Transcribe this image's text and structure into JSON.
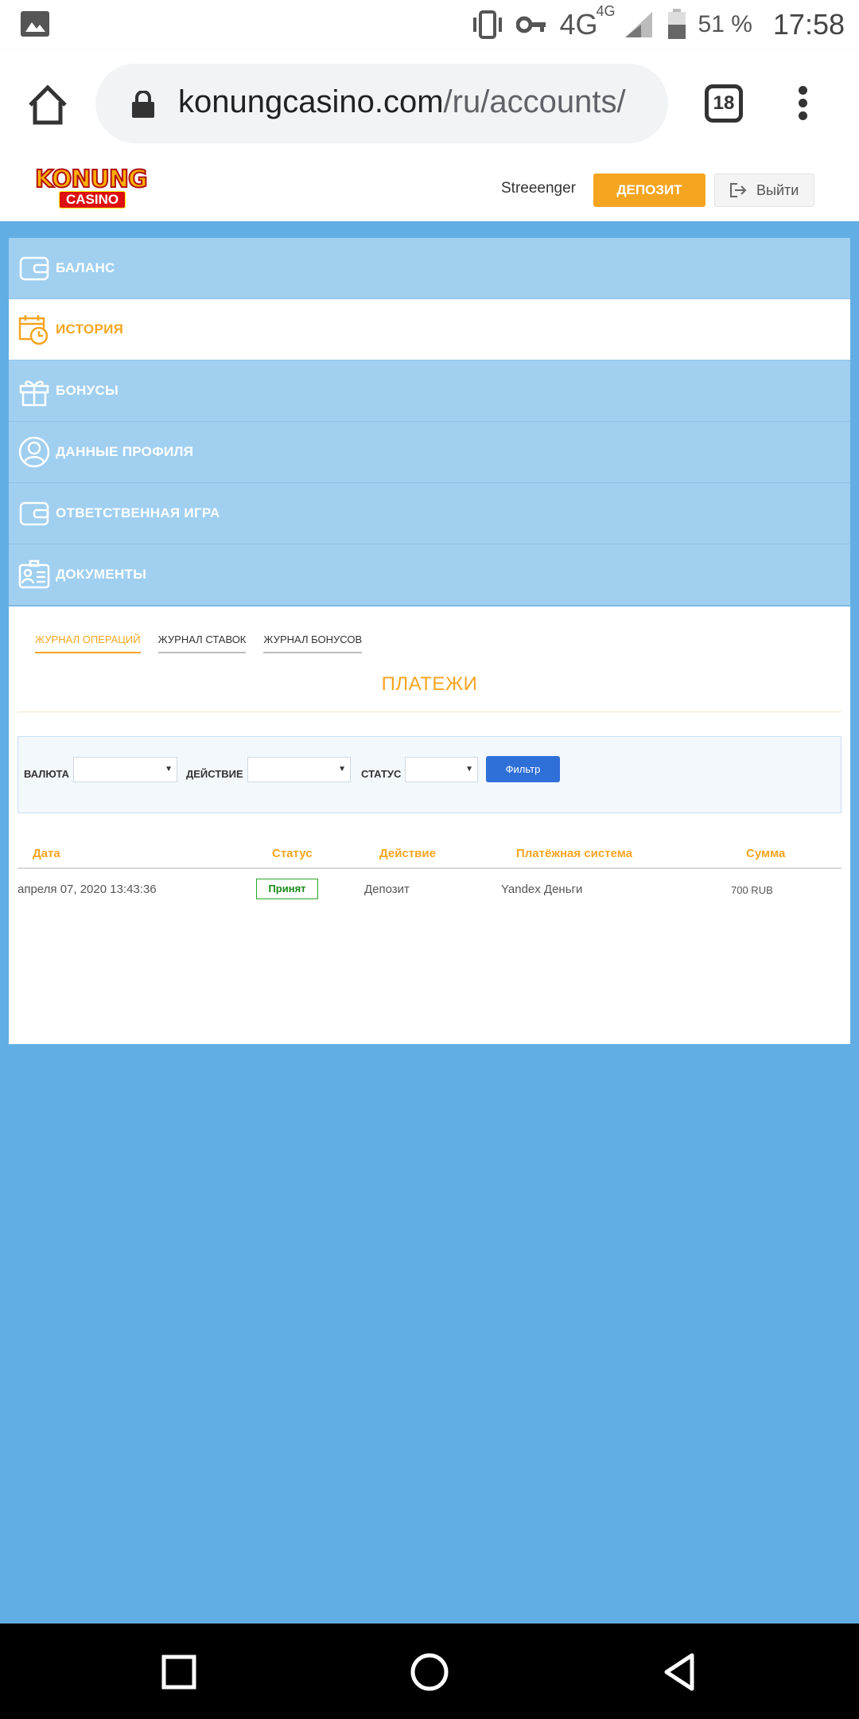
{
  "status_bar": {
    "network": "4G",
    "network_sup": "4G",
    "battery": "51 %",
    "time": "17:58",
    "icons": [
      "gallery-icon",
      "vibrate-icon",
      "vpn-key-icon",
      "signal-icon",
      "battery-icon"
    ]
  },
  "browser": {
    "url_host": "konungcasino.com",
    "url_path": "/ru/accounts/",
    "tab_count": "18"
  },
  "header": {
    "logo_main": "KONUNG",
    "logo_sub": "CASINO",
    "username": "Streeenger",
    "deposit_label": "ДЕПОЗИТ",
    "logout_label": "Выйти"
  },
  "account_menu": {
    "items": [
      {
        "label": "БАЛАНС",
        "icon": "wallet-icon",
        "active": false
      },
      {
        "label": "ИСТОРИЯ",
        "icon": "calendar-clock-icon",
        "active": true
      },
      {
        "label": "БОНУСЫ",
        "icon": "gift-icon",
        "active": false
      },
      {
        "label": "ДАННЫЕ ПРОФИЛЯ",
        "icon": "user-icon",
        "active": false
      },
      {
        "label": "ОТВЕТСТВЕННАЯ ИГРА",
        "icon": "wallet-icon",
        "active": false
      },
      {
        "label": "ДОКУМЕНТЫ",
        "icon": "id-card-icon",
        "active": false
      }
    ]
  },
  "history": {
    "tabs": [
      {
        "label": "ЖУРНАЛ ОПЕРАЦИЙ",
        "active": true
      },
      {
        "label": "ЖУРНАЛ СТАВОК",
        "active": false
      },
      {
        "label": "ЖУРНАЛ БОНУСОВ",
        "active": false
      }
    ],
    "title": "ПЛАТЕЖИ",
    "filters": {
      "currency_label": "ВАЛЮТА",
      "action_label": "ДЕЙСТВИЕ",
      "status_label": "СТАТУС",
      "filter_button": "Фильтр"
    },
    "table": {
      "headers": [
        "Дата",
        "Статус",
        "Действие",
        "Платёжная система",
        "Сумма"
      ],
      "rows": [
        {
          "date": "апреля 07, 2020 13:43:36",
          "status": "Принят",
          "action": "Депозит",
          "system": "Yandex Деньги",
          "amount": "700 RUB"
        }
      ]
    }
  },
  "colors": {
    "accent": "#f6a521",
    "menu_bg": "#a0cff0",
    "page_bg": "#62aee4",
    "filter_button": "#2f6fd8",
    "status_ok": "#2aa52a"
  }
}
